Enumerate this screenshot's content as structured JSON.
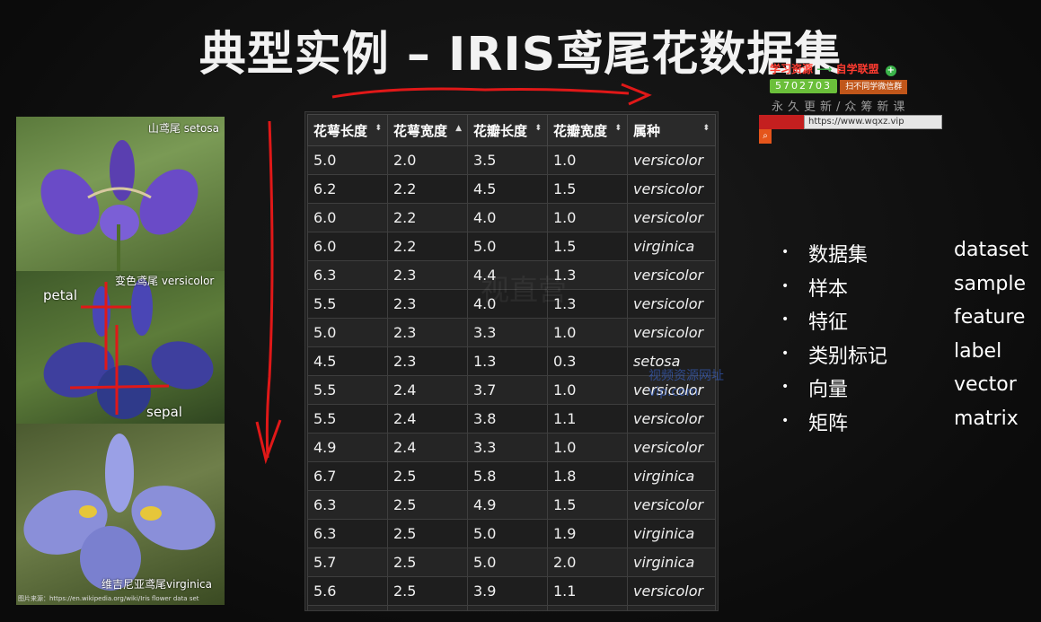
{
  "title": "典型实例 – IRIS鸢尾花数据集",
  "promo": {
    "line1_left": "学习资源",
    "line1_right": "自学联盟",
    "qq": "5702703",
    "qq_hint": "扫不同学微信群",
    "line3": "永久更新/众筹新课",
    "url": "https://www.wqxz.vip"
  },
  "photos": {
    "setosa_caption": "山鸢尾 setosa",
    "versicolor_caption": "变色鸢尾 versicolor",
    "petal_label": "petal",
    "sepal_label": "sepal",
    "virginica_caption": "维吉尼亚鸢尾virginica",
    "credit": "图片来源：https://en.wikipedia.org/wiki/Iris flower data set"
  },
  "table": {
    "headers": [
      "花萼长度",
      "花萼宽度",
      "花瓣长度",
      "花瓣宽度",
      "属种"
    ],
    "sort_icons": [
      "⬍",
      "▲",
      "⬍",
      "⬍",
      "⬍"
    ],
    "rows": [
      [
        "5.0",
        "2.0",
        "3.5",
        "1.0",
        "versicolor"
      ],
      [
        "6.2",
        "2.2",
        "4.5",
        "1.5",
        "versicolor"
      ],
      [
        "6.0",
        "2.2",
        "4.0",
        "1.0",
        "versicolor"
      ],
      [
        "6.0",
        "2.2",
        "5.0",
        "1.5",
        "virginica"
      ],
      [
        "6.3",
        "2.3",
        "4.4",
        "1.3",
        "versicolor"
      ],
      [
        "5.5",
        "2.3",
        "4.0",
        "1.3",
        "versicolor"
      ],
      [
        "5.0",
        "2.3",
        "3.3",
        "1.0",
        "versicolor"
      ],
      [
        "4.5",
        "2.3",
        "1.3",
        "0.3",
        "setosa"
      ],
      [
        "5.5",
        "2.4",
        "3.7",
        "1.0",
        "versicolor"
      ],
      [
        "5.5",
        "2.4",
        "3.8",
        "1.1",
        "versicolor"
      ],
      [
        "4.9",
        "2.4",
        "3.3",
        "1.0",
        "versicolor"
      ],
      [
        "6.7",
        "2.5",
        "5.8",
        "1.8",
        "virginica"
      ],
      [
        "6.3",
        "2.5",
        "4.9",
        "1.5",
        "versicolor"
      ],
      [
        "6.3",
        "2.5",
        "5.0",
        "1.9",
        "virginica"
      ],
      [
        "5.7",
        "2.5",
        "5.0",
        "2.0",
        "virginica"
      ],
      [
        "5.6",
        "2.5",
        "3.9",
        "1.1",
        "versicolor"
      ],
      [
        "",
        "",
        "",
        "",
        ""
      ]
    ]
  },
  "watermark_center": "视直营",
  "watermark_blue": [
    "视频资源网址",
    "vip.com"
  ],
  "terms": [
    {
      "zh": "数据集",
      "en": "dataset"
    },
    {
      "zh": "样本",
      "en": "sample"
    },
    {
      "zh": "特征",
      "en": "feature"
    },
    {
      "zh": "类别标记",
      "en": "label"
    },
    {
      "zh": "向量",
      "en": "vector"
    },
    {
      "zh": "矩阵",
      "en": "matrix"
    }
  ],
  "colors": {
    "annotation": "#e01818",
    "background": "#101010",
    "table_header": "#2a2a2a"
  }
}
